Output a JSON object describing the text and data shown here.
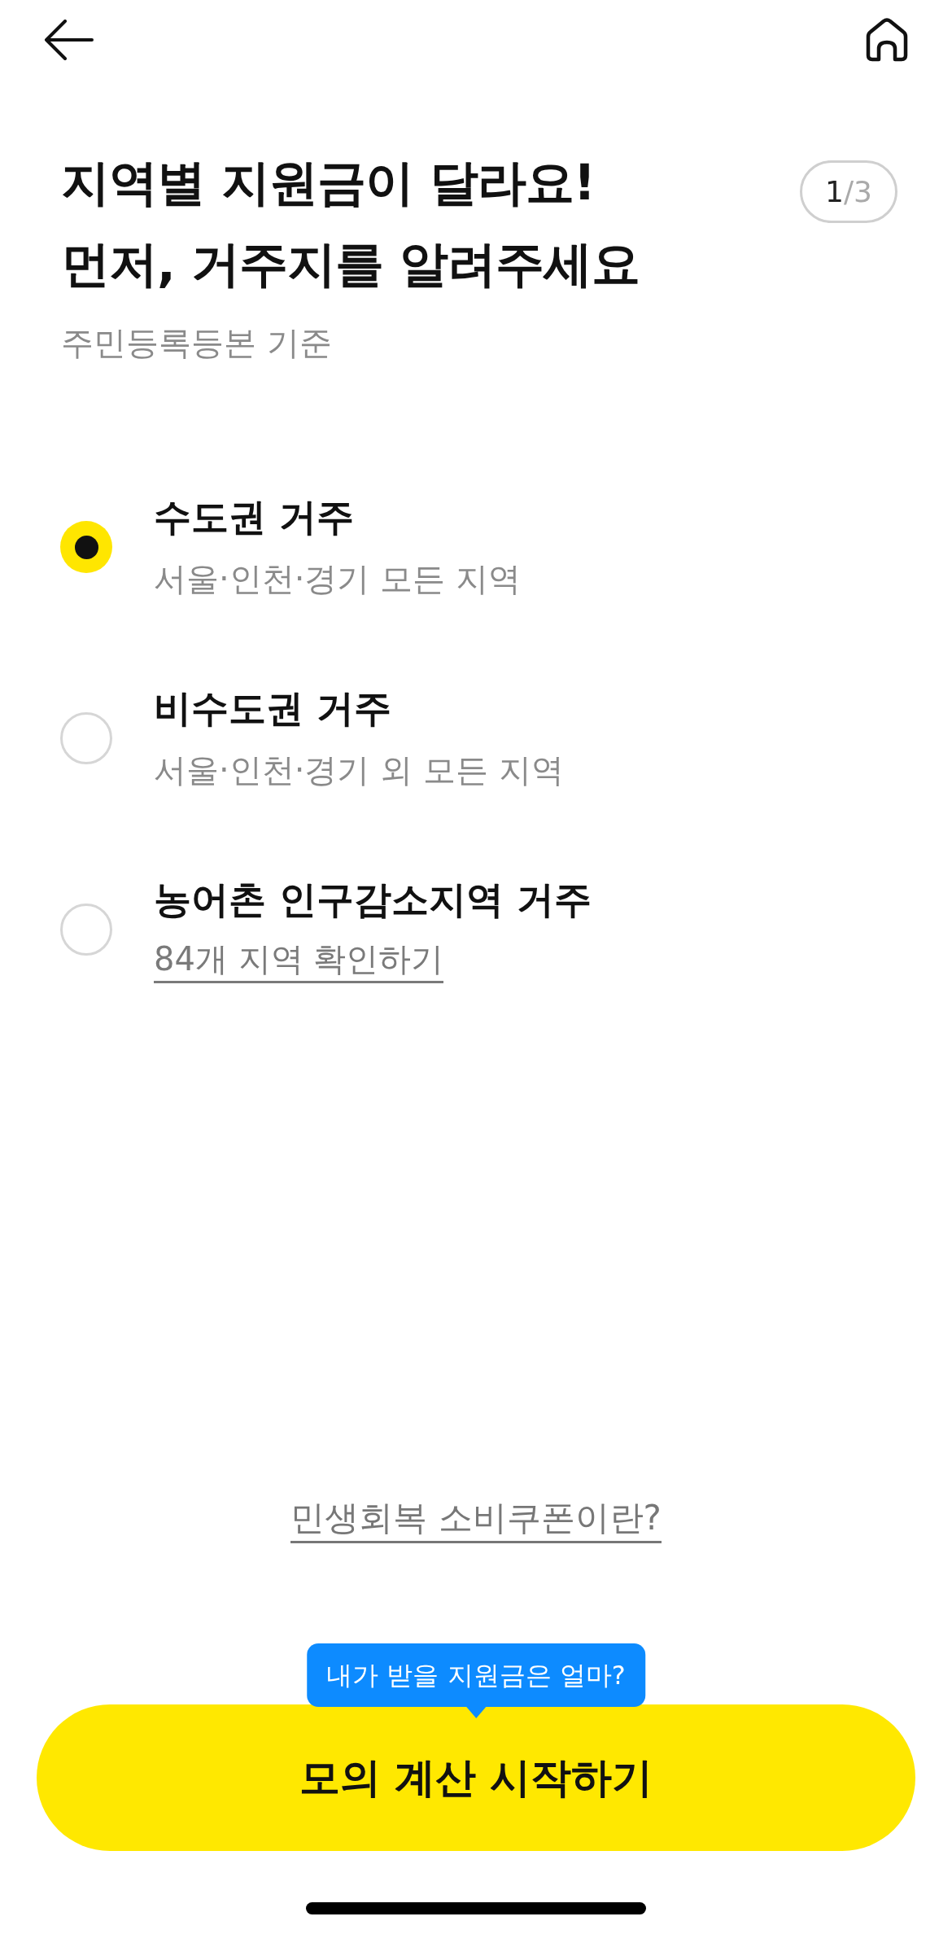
{
  "header": {
    "title_lines": [
      "지역별 지원금이 달라요!",
      "먼저, 거주지를 알려주세요"
    ],
    "step": {
      "current": "1",
      "rest": "/3"
    },
    "subtitle": "주민등록등본 기준"
  },
  "options": [
    {
      "title": "수도권 거주",
      "kind": "text",
      "detail": "서울·인천·경기 모든 지역",
      "selected": true
    },
    {
      "title": "비수도권 거주",
      "kind": "text",
      "detail": "서울·인천·경기 외 모든 지역",
      "selected": false
    },
    {
      "title": "농어촌 인구감소지역 거주",
      "kind": "link",
      "detail": "84개 지역 확인하기",
      "selected": false
    }
  ],
  "footer": {
    "info_link": "민생회복 소비쿠폰이란?",
    "tooltip": "내가 받을 지원금은 얼마?",
    "primary_button": "모의 계산 시작하기"
  }
}
